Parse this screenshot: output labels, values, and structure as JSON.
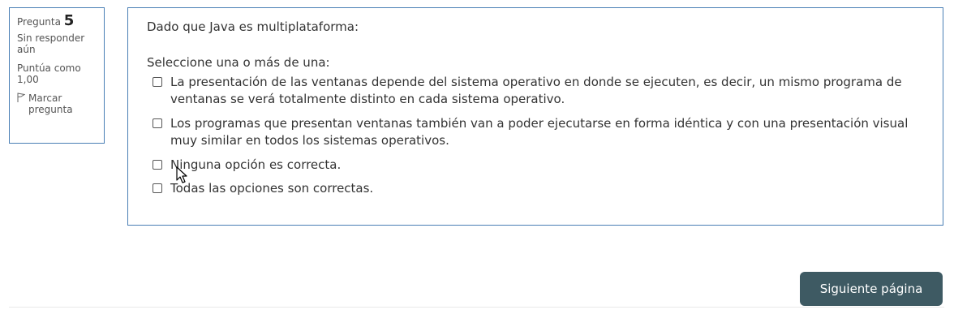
{
  "info": {
    "question_label": "Pregunta",
    "question_number": "5",
    "status": "Sin responder aún",
    "score": "Puntúa como 1,00",
    "flag_label": "Marcar pregunta"
  },
  "question": {
    "text": "Dado que Java es multiplataforma:",
    "prompt": "Seleccione una o más de una:",
    "options": [
      {
        "label": "La presentación de las ventanas depende del sistema operativo en donde se ejecuten, es decir, un mismo programa de ventanas se verá totalmente distinto en cada sistema operativo.",
        "checked": false
      },
      {
        "label": "Los programas que presentan ventanas también van a poder ejecutarse en forma idéntica y con una presentación visual muy similar en todos los sistemas operativos.",
        "checked": false
      },
      {
        "label": "Ninguna opción es correcta.",
        "checked": false
      },
      {
        "label": "Todas las opciones son correctas.",
        "checked": false
      }
    ]
  },
  "navigation": {
    "next_label": "Siguiente página"
  },
  "icons": {
    "flag": "flag-icon",
    "cursor": "mouse-pointer-icon"
  },
  "colors": {
    "border": "#4a7fb5",
    "button": "#3e5a63"
  }
}
